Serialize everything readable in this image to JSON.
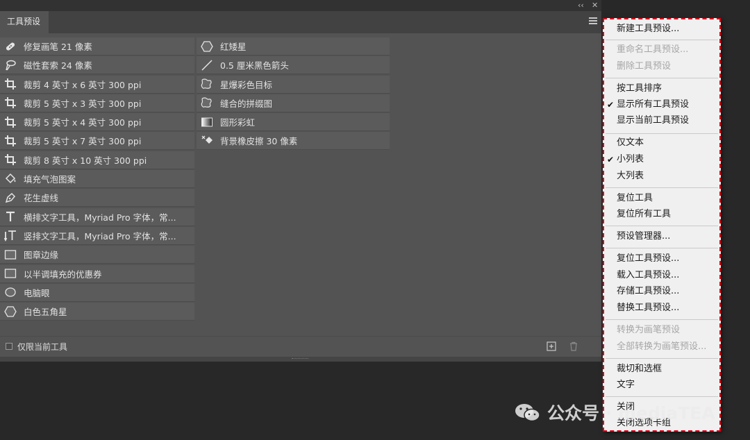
{
  "window": {
    "collapse_glyph": "‹‹",
    "close_glyph": "✕"
  },
  "panel": {
    "tab_title": "工具预设",
    "menu_icon": "hamburger-icon",
    "col1": [
      {
        "icon": "healing-brush-icon",
        "label": "修复画笔 21 像素"
      },
      {
        "icon": "magnetic-lasso-icon",
        "label": "磁性套索 24 像素"
      },
      {
        "icon": "crop-icon",
        "label": "裁剪 4 英寸 x 6 英寸 300 ppi"
      },
      {
        "icon": "crop-icon",
        "label": "裁剪 5 英寸 x 3 英寸 300 ppi"
      },
      {
        "icon": "crop-icon",
        "label": "裁剪 5 英寸 x 4 英寸 300 ppi"
      },
      {
        "icon": "crop-icon",
        "label": "裁剪 5 英寸 x 7 英寸 300 ppi"
      },
      {
        "icon": "crop-icon",
        "label": "裁剪 8 英寸 x 10 英寸 300 ppi"
      },
      {
        "icon": "paint-bucket-icon",
        "label": "填充气泡图案"
      },
      {
        "icon": "pen-icon",
        "label": "花生虚线"
      },
      {
        "icon": "horizontal-type-icon",
        "label": "横排文字工具，Myriad Pro 字体，常..."
      },
      {
        "icon": "vertical-type-icon",
        "label": "竖排文字工具，Myriad Pro 字体，常..."
      },
      {
        "icon": "rectangle-icon",
        "label": "图章边缘"
      },
      {
        "icon": "rectangle-icon",
        "label": "以半调填充的优惠券"
      },
      {
        "icon": "ellipse-icon",
        "label": "电脑眼"
      },
      {
        "icon": "polygon-icon",
        "label": "白色五角星"
      }
    ],
    "col2": [
      {
        "icon": "polygon-icon",
        "label": "红矮星"
      },
      {
        "icon": "line-icon",
        "label": "0.5 厘米黑色箭头"
      },
      {
        "icon": "custom-shape-icon",
        "label": "星爆彩色目标"
      },
      {
        "icon": "custom-shape-icon",
        "label": "缝合的拼缀图"
      },
      {
        "icon": "gradient-icon",
        "label": "圆形彩虹"
      },
      {
        "icon": "background-eraser-icon",
        "label": "背景橡皮擦 30 像素"
      }
    ],
    "footer": {
      "current_tool_only": "仅限当前工具",
      "current_tool_only_checked": false,
      "new_icon": "new-preset-icon",
      "delete_icon": "trash-icon"
    }
  },
  "menu": {
    "items": [
      {
        "label": "新建工具预设...",
        "disabled": false,
        "checked": false
      },
      {
        "label": "重命名工具预设...",
        "disabled": true,
        "checked": false
      },
      {
        "label": "删除工具预设",
        "disabled": true,
        "checked": false
      },
      {
        "label": "按工具排序",
        "disabled": false,
        "checked": false
      },
      {
        "label": "显示所有工具预设",
        "disabled": false,
        "checked": true
      },
      {
        "label": "显示当前工具预设",
        "disabled": false,
        "checked": false
      },
      {
        "label": "仅文本",
        "disabled": false,
        "checked": false
      },
      {
        "label": "小列表",
        "disabled": false,
        "checked": true
      },
      {
        "label": "大列表",
        "disabled": false,
        "checked": false
      },
      {
        "label": "复位工具",
        "disabled": false,
        "checked": false
      },
      {
        "label": "复位所有工具",
        "disabled": false,
        "checked": false
      },
      {
        "label": "预设管理器...",
        "disabled": false,
        "checked": false
      },
      {
        "label": "复位工具预设...",
        "disabled": false,
        "checked": false
      },
      {
        "label": "载入工具预设...",
        "disabled": false,
        "checked": false
      },
      {
        "label": "存储工具预设...",
        "disabled": false,
        "checked": false
      },
      {
        "label": "替换工具预设...",
        "disabled": false,
        "checked": false
      },
      {
        "label": "转换为画笔预设",
        "disabled": true,
        "checked": false
      },
      {
        "label": "全部转换为画笔预设...",
        "disabled": true,
        "checked": false
      },
      {
        "label": "裁切和选框",
        "disabled": false,
        "checked": false
      },
      {
        "label": "文字",
        "disabled": false,
        "checked": false
      },
      {
        "label": "关闭",
        "disabled": false,
        "checked": false
      },
      {
        "label": "关闭选项卡组",
        "disabled": false,
        "checked": false
      }
    ],
    "check_glyph": "✔"
  },
  "watermark": {
    "icon": "wechat-icon",
    "text": "公众号 · mediaTEA"
  },
  "colors": {
    "panel_bg": "#535353",
    "item_bg": "#5b5b5b",
    "menu_bg": "#f0f0f0",
    "highlight_border": "#e0001a"
  }
}
